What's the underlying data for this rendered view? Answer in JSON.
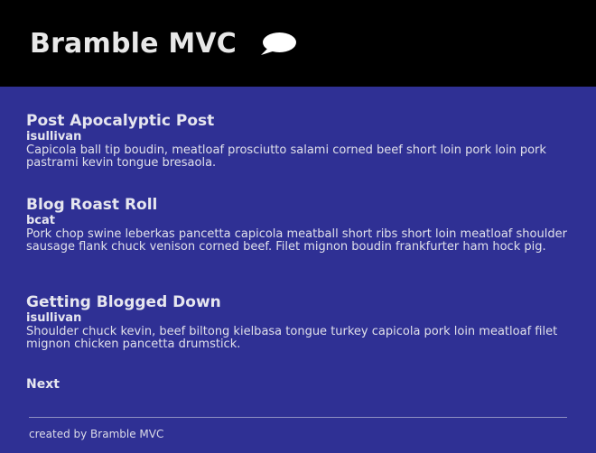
{
  "header": {
    "title": "Bramble MVC",
    "icon": "chat-bubble-icon"
  },
  "posts": [
    {
      "title": "Post Apocalyptic Post",
      "author": "isullivan",
      "body": "Capicola ball tip boudin, meatloaf prosciutto salami corned beef short loin pork loin pork pastrami kevin tongue bresaola."
    },
    {
      "title": "Blog Roast Roll",
      "author": "bcat",
      "body": "Pork chop swine leberkas pancetta capicola meatball short ribs short loin meatloaf shoulder sausage flank chuck venison corned beef. Filet mignon boudin frankfurter ham hock pig."
    },
    {
      "title": "Getting Blogged Down",
      "author": "isullivan",
      "body": "Shoulder chuck kevin, beef biltong kielbasa tongue turkey capicola pork loin meatloaf filet mignon chicken pancetta drumstick."
    }
  ],
  "pagination": {
    "next_label": "Next"
  },
  "footer": {
    "text": "created by Bramble MVC"
  },
  "colors": {
    "header_bg": "#000000",
    "page_bg": "#2f3094",
    "text": "#e3e3ee"
  }
}
